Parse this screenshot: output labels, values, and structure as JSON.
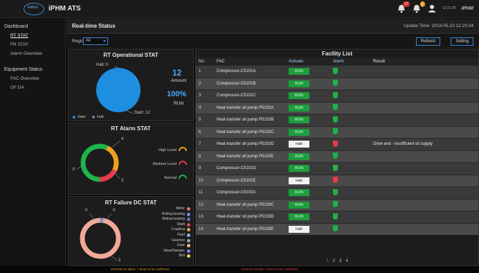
{
  "app": {
    "title": "iPHM ATS",
    "logo_text": "eaton",
    "brand": "iPHM",
    "user_time": "12:21:35",
    "badge_red": "17",
    "badge_yellow": "1"
  },
  "sidebar": {
    "sections": [
      {
        "label": "Dashboard",
        "items": [
          {
            "label": "RT STAT"
          },
          {
            "label": "FR STAT"
          },
          {
            "label": "Alarm Overview"
          }
        ]
      },
      {
        "label": "Equipment Status",
        "items": [
          {
            "label": "FAC Overview"
          },
          {
            "label": "GF DA"
          }
        ]
      }
    ]
  },
  "rt_header": {
    "title": "Real-time Status",
    "update_label": "Update Time: 2018-05-23 12:20:34"
  },
  "filter": {
    "label": "Region",
    "value": "All",
    "refresh_label": "Refresh",
    "settings_label": "Setting"
  },
  "op_stat": {
    "title": "RT Operational STAT",
    "halt_label": "Halt: 0",
    "amount_value": "12",
    "amount_label": "Amount",
    "percent_value": "100%",
    "percent_label": "RUN",
    "start_label": "Start: 12",
    "legend_start": "Start",
    "legend_halt": "Halt"
  },
  "alarm_stat": {
    "title": "RT Alarm STAT",
    "label_top": "4",
    "label_left": "0",
    "label_right": "3",
    "legend": [
      "High Level",
      "Medium Level",
      "Normal"
    ],
    "colors": [
      "#f0a020",
      "#e83a4a",
      "#1db44a"
    ]
  },
  "failure_stat": {
    "title": "RT Failure DC STAT",
    "label_top_left": "0",
    "label_top_right": "0",
    "label_bottom": "2",
    "legend": [
      "Motor",
      "Rolling bearing",
      "Sliding bearing",
      "Shaft",
      "Coupling",
      "Fluid",
      "Gearbox",
      "Gear",
      "Valve/Damper",
      "Belt"
    ],
    "colors": [
      "#f07060",
      "#7090e0",
      "#6a6ac8",
      "#d05050",
      "#e0a050",
      "#90b0e0",
      "#a0a0a0",
      "#f0c070",
      "#8080f0",
      "#f0d050"
    ]
  },
  "facility": {
    "title": "Facility List",
    "headers": [
      "No.",
      "FAC",
      "Activate",
      "Alarm",
      "Result"
    ],
    "rows": [
      {
        "no": "1",
        "fac": "Compressor-C5101A",
        "act": "RUN",
        "stop": false,
        "alarm": "green",
        "result": ""
      },
      {
        "no": "2",
        "fac": "Compressor-C5101B",
        "act": "RUN",
        "stop": false,
        "alarm": "green",
        "result": ""
      },
      {
        "no": "3",
        "fac": "Compressor-C5101C",
        "act": "RUN",
        "stop": false,
        "alarm": "green",
        "result": ""
      },
      {
        "no": "4",
        "fac": "Heat-transfer oil pump P5102A",
        "act": "RUN",
        "stop": false,
        "alarm": "green",
        "result": ""
      },
      {
        "no": "5",
        "fac": "Heat-transfer oil pump P5102B",
        "act": "RUN",
        "stop": false,
        "alarm": "green",
        "result": ""
      },
      {
        "no": "6",
        "fac": "Heat-transfer oil pump P5102C",
        "act": "RUN",
        "stop": false,
        "alarm": "green",
        "result": ""
      },
      {
        "no": "7",
        "fac": "Heat-transfer oil pump P5102D",
        "act": "Halt",
        "stop": true,
        "alarm": "red",
        "result": "Drive end - insufficient oil supply"
      },
      {
        "no": "8",
        "fac": "Heat-transfer oil pump P5102E",
        "act": "RUN",
        "stop": false,
        "alarm": "green",
        "result": ""
      },
      {
        "no": "9",
        "fac": "Compressor-C5101D",
        "act": "RUN",
        "stop": false,
        "alarm": "green",
        "result": ""
      },
      {
        "no": "10",
        "fac": "Compressor-C5101E",
        "act": "Halt",
        "stop": true,
        "alarm": "red",
        "result": ""
      },
      {
        "no": "11",
        "fac": "Compressor-C5102A",
        "act": "RUN",
        "stop": false,
        "alarm": "green",
        "result": ""
      },
      {
        "no": "12",
        "fac": "Heat-transfer oil pump P5103C",
        "act": "RUN",
        "stop": false,
        "alarm": "green",
        "result": ""
      },
      {
        "no": "13",
        "fac": "Heat-transfer oil pump P5103D",
        "act": "RUN",
        "stop": false,
        "alarm": "green",
        "result": ""
      },
      {
        "no": "14",
        "fac": "Heat-transfer oil pump P5103E",
        "act": "Halt",
        "stop": true,
        "alarm": "green",
        "result": ""
      }
    ],
    "pages": [
      "1",
      "2",
      "3",
      "4"
    ]
  },
  "footer": {
    "left": "2018-05-23 alarm: 7 items to be confirmed",
    "right": "2018-05-23 stop: 3 items to be confirmed"
  }
}
